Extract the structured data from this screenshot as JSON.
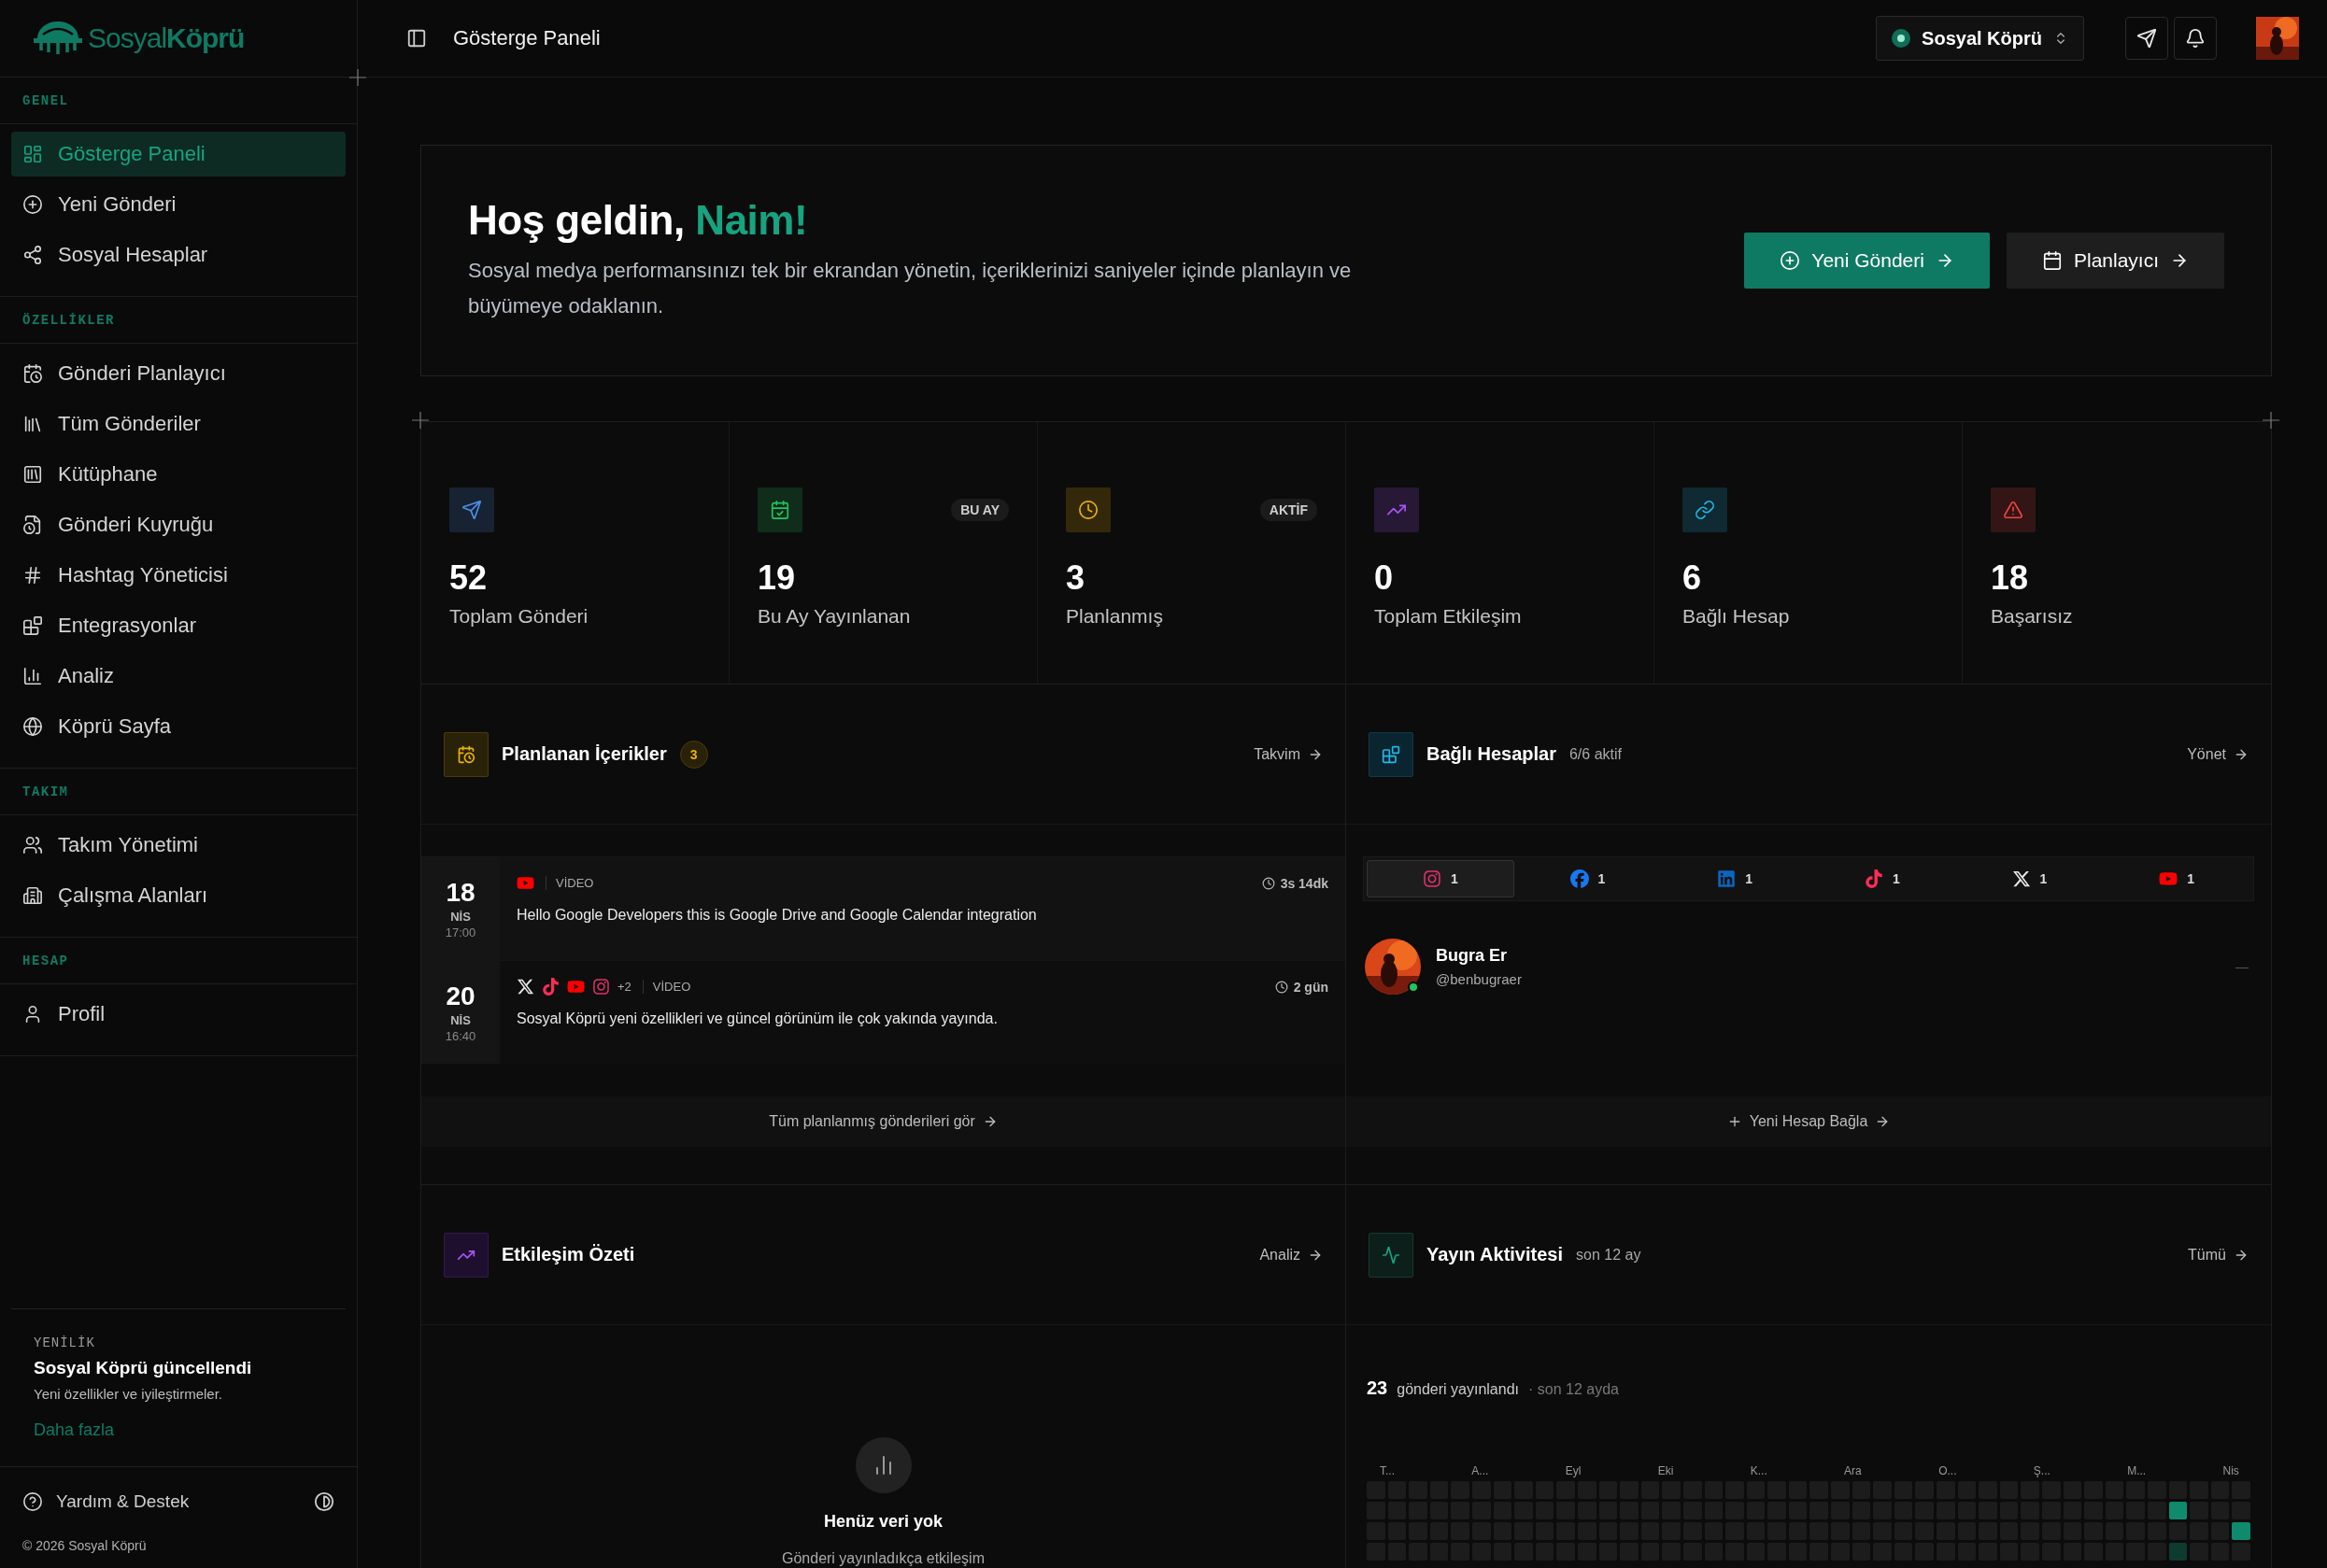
{
  "sidebar": {
    "logo": "Sosyal**Köprü**",
    "sections": [
      {
        "label": "GENEL",
        "items": [
          {
            "kind": "dashboard",
            "label": "Gösterge Paneli",
            "selected": true
          },
          {
            "kind": "plus",
            "label": "Yeni Gönderi",
            "selected": false
          },
          {
            "kind": "share",
            "label": "Sosyal Hesaplar",
            "selected": false
          }
        ]
      },
      {
        "label": "ÖZELLİKLER",
        "items": [
          {
            "kind": "calendar-clock",
            "label": "Gönderi Planlayıcı",
            "selected": false
          },
          {
            "kind": "library",
            "label": "Tüm Gönderiler",
            "selected": false
          },
          {
            "kind": "square-library",
            "label": "Kütüphane",
            "selected": false
          },
          {
            "kind": "file-clock",
            "label": "Gönderi Kuyruğu",
            "selected": false
          },
          {
            "kind": "hash",
            "label": "Hashtag Yöneticisi",
            "selected": false
          },
          {
            "kind": "blocks",
            "label": "Entegrasyonlar",
            "selected": false
          },
          {
            "kind": "chart",
            "label": "Analiz",
            "selected": false
          },
          {
            "kind": "globe",
            "label": "Köprü Sayfa",
            "selected": false
          }
        ]
      },
      {
        "label": "TAKIM",
        "items": [
          {
            "kind": "users",
            "label": "Takım Yönetimi",
            "selected": false
          },
          {
            "kind": "building",
            "label": "Çalışma Alanları",
            "selected": false
          }
        ]
      },
      {
        "label": "HESAP",
        "items": [
          {
            "kind": "user",
            "label": "Profil",
            "selected": false
          }
        ]
      }
    ],
    "update": {
      "eyebrow": "YENİLİK",
      "title": "Sosyal Köprü güncellendi",
      "text": "Yeni özellikler ve iyileştirmeler.",
      "link": "Daha fazla"
    },
    "help": "Yardım & Destek",
    "copyright": "© 2026 Sosyal Köprü"
  },
  "header": {
    "title": "Gösterge Paneli",
    "workspace": "Sosyal Köprü"
  },
  "welcome": {
    "greeting": "Hoş geldin,",
    "name": "Naim!",
    "text": "Sosyal medya performansınızı tek bir ekrandan yönetin, içeriklerinizi saniyeler içinde planlayın ve büyümeye odaklanın.",
    "buttons": [
      {
        "kind": "primary",
        "label": "Yeni Gönderi"
      },
      {
        "kind": "secondary",
        "label": "Planlayıcı"
      }
    ]
  },
  "stats": [
    {
      "kind": "send",
      "color": "#4d8fe8",
      "value": "52",
      "label": "Toplam Gönderi"
    },
    {
      "kind": "calendar-check",
      "color": "#22c55e",
      "badge": "BU AY",
      "value": "19",
      "label": "Bu Ay Yayınlanan"
    },
    {
      "kind": "clock",
      "color": "#eab308",
      "badge": "AKTİF",
      "value": "3",
      "label": "Planlanmış"
    },
    {
      "kind": "trending",
      "color": "#a855f7",
      "value": "0",
      "label": "Toplam Etkileşim"
    },
    {
      "kind": "link",
      "color": "#22b8e6",
      "value": "6",
      "label": "Bağlı Hesap"
    },
    {
      "kind": "alert",
      "color": "#ef4444",
      "value": "18",
      "label": "Başarısız"
    }
  ],
  "scheduled": {
    "title": "Planlanan İçerikler",
    "count": "3",
    "link": "Takvim",
    "items": [
      {
        "day": "18",
        "month": "NİS",
        "time": "17:00",
        "platforms": [
          {
            "kind": "youtube"
          }
        ],
        "type": "VİDEO",
        "due": "3s 14dk",
        "text": "Hello Google Developers this is Google Drive and Google Calendar integration"
      },
      {
        "day": "20",
        "month": "NİS",
        "time": "16:40",
        "platforms": [
          {
            "kind": "x"
          },
          {
            "kind": "tiktok"
          },
          {
            "kind": "youtube"
          },
          {
            "kind": "instagram"
          }
        ],
        "more": "+2",
        "type": "VİDEO",
        "due": "2 gün",
        "text": "Sosyal Köprü yeni özellikleri ve güncel görünüm ile çok yakında yayında."
      }
    ],
    "footer": "Tüm planlanmış gönderileri gör"
  },
  "accounts": {
    "title": "Bağlı Hesaplar",
    "status": "6/6 aktif",
    "link": "Yönet",
    "tabs": [
      {
        "kind": "instagram",
        "count": "1",
        "selected": true
      },
      {
        "kind": "facebook",
        "count": "1",
        "selected": false
      },
      {
        "kind": "linkedin",
        "count": "1",
        "selected": false
      },
      {
        "kind": "tiktok",
        "count": "1",
        "selected": false
      },
      {
        "kind": "x",
        "count": "1",
        "selected": false
      },
      {
        "kind": "youtube",
        "count": "1",
        "selected": false
      }
    ],
    "list": [
      {
        "name": "Bugra Er",
        "handle": "@benbugraer",
        "online": true,
        "trailing": "—"
      }
    ],
    "footer": "Yeni Hesap Bağla"
  },
  "engagement": {
    "title": "Etkileşim Özeti",
    "link": "Analiz",
    "empty_title": "Henüz veri yok",
    "empty_text": "Gönderi yayınladıkça etkileşim"
  },
  "activity": {
    "title": "Yayın Aktivitesi",
    "period": "son 12 ay",
    "link": "Tümü",
    "total": "23",
    "total_label": "gönderi yayınlandı",
    "total_period": "· son 12 ayda",
    "months": [
      "T...",
      "A...",
      "Eyl",
      "Eki",
      "K...",
      "Ara",
      "O...",
      "Ş...",
      "M...",
      "Nis"
    ]
  }
}
